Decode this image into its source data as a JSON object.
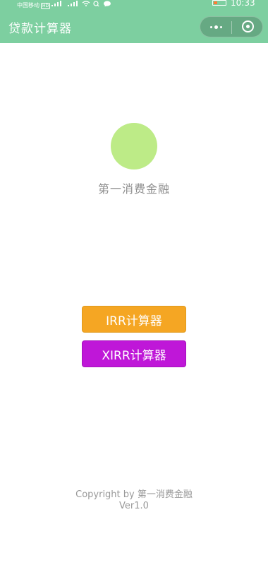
{
  "status_bar": {
    "carrier": "中国移动",
    "network_badge": "HD",
    "time": "10:33",
    "icons": [
      "signal-icon",
      "signal-icon",
      "wifi-icon",
      "search-icon",
      "message-icon",
      "battery-icon"
    ],
    "battery_level": 0.3
  },
  "nav": {
    "title": "贷款计算器",
    "more_icon": "more-dots-icon",
    "close_icon": "close-circle-icon"
  },
  "main": {
    "org_name": "第一消费金融",
    "buttons": [
      {
        "label": "IRR计算器",
        "color": "#f5a623"
      },
      {
        "label": "XIRR计算器",
        "color": "#bf17d8"
      }
    ]
  },
  "footer": {
    "copyright": "Copyright by 第一消费金融",
    "version": "Ver1.0"
  },
  "colors": {
    "header_bg": "#7dcfa0",
    "logo": "#bdeb87"
  }
}
